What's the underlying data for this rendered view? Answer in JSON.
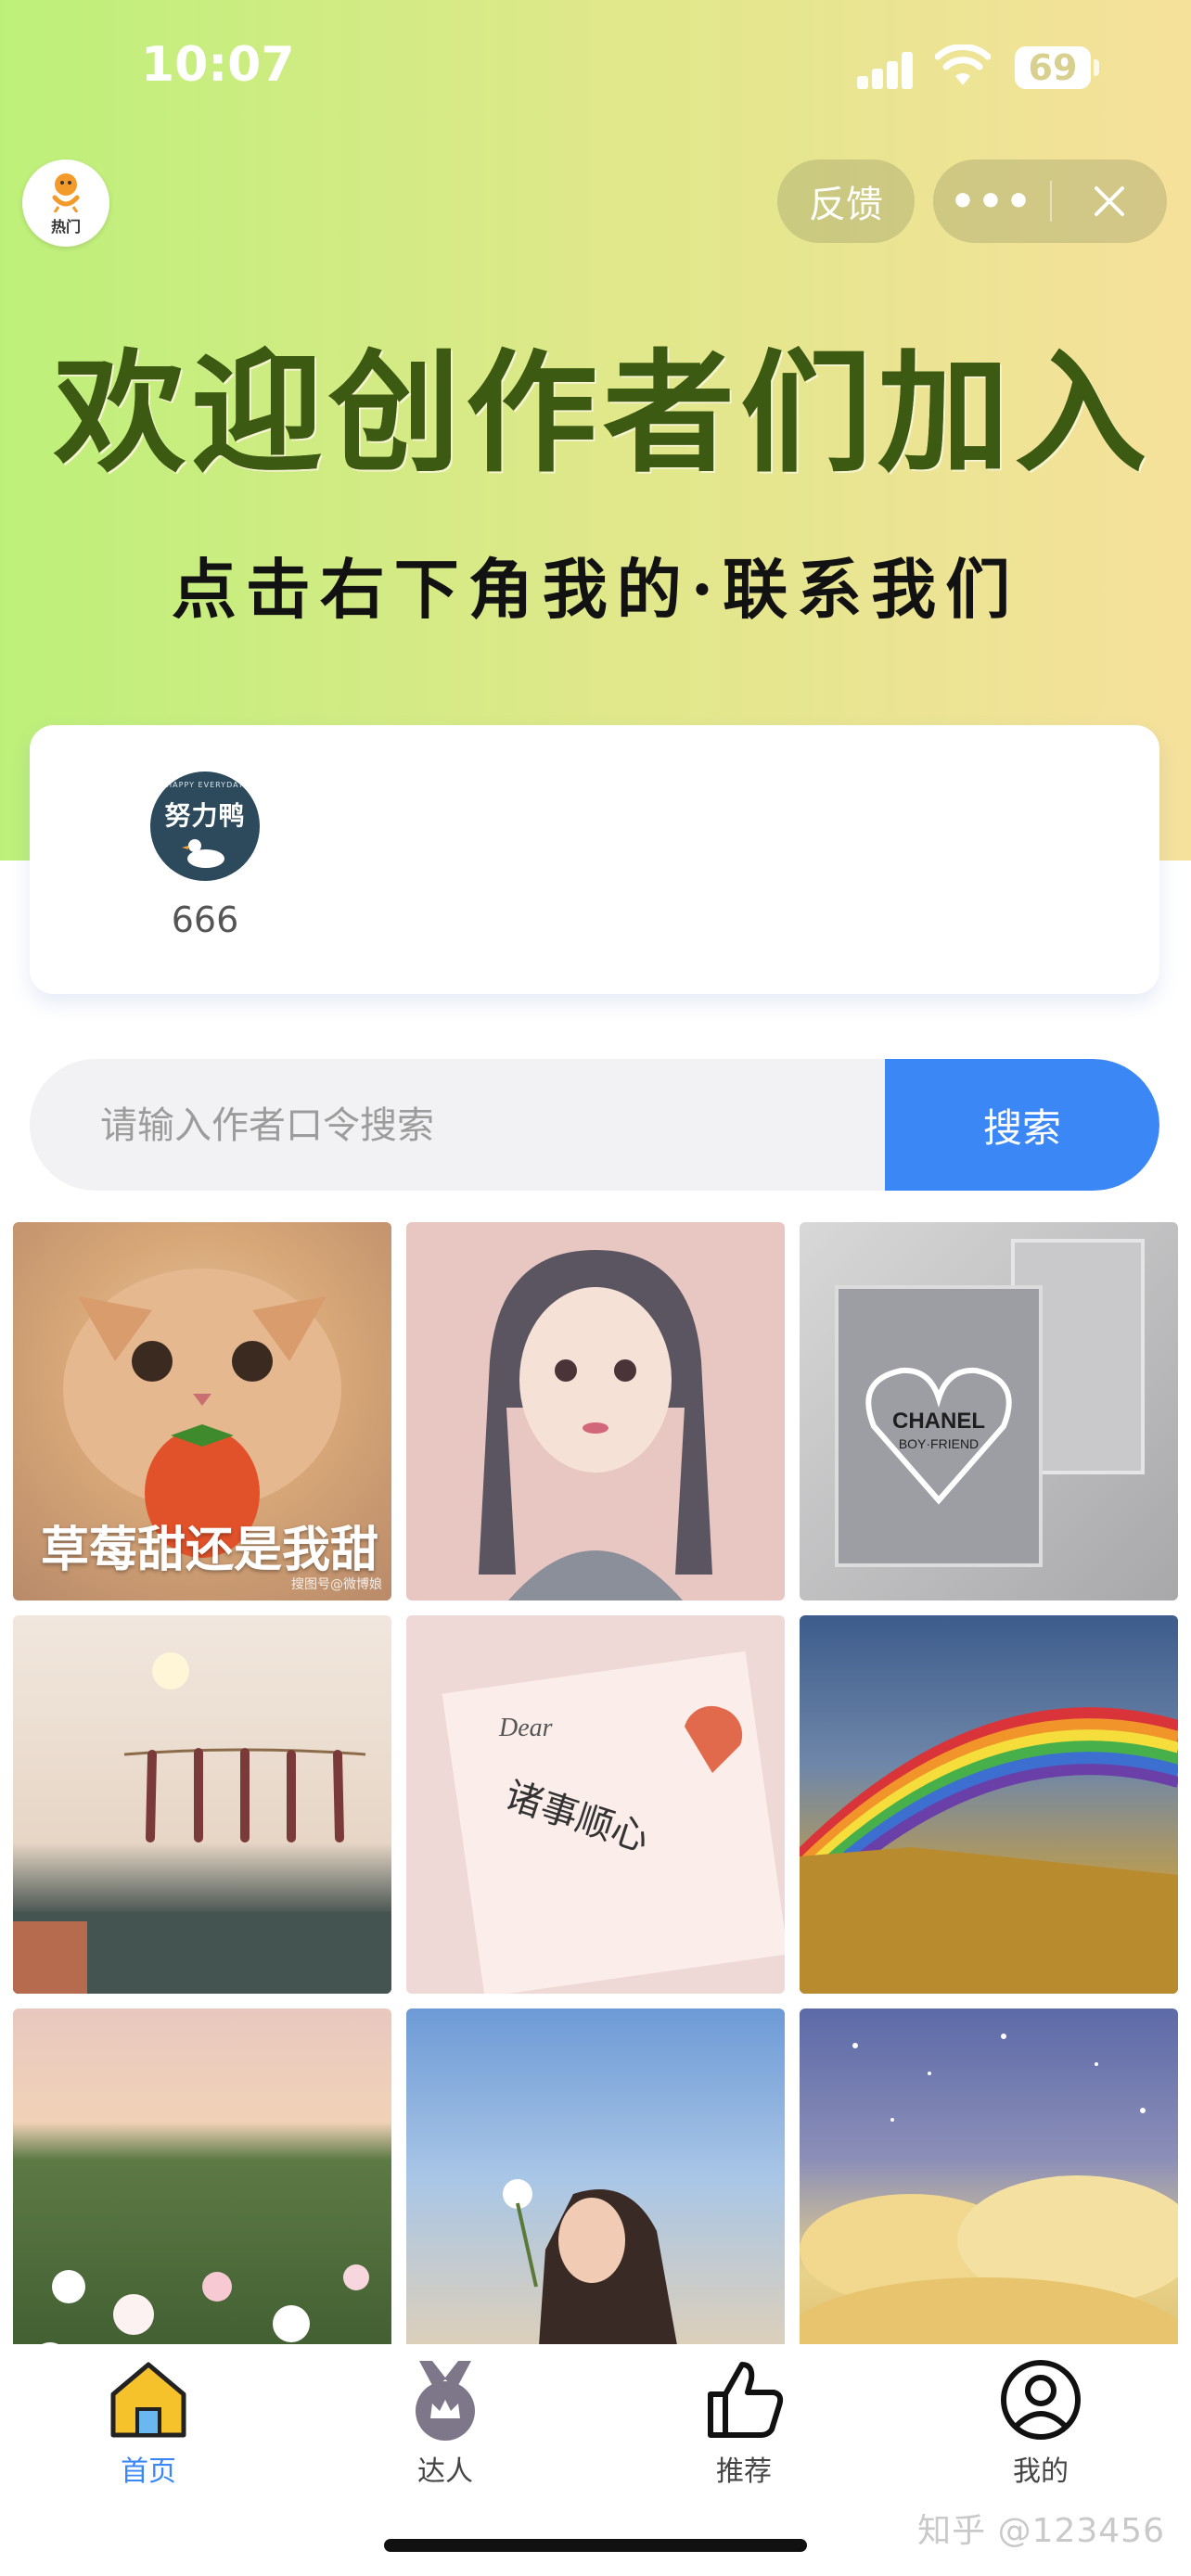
{
  "status_bar": {
    "time": "10:07",
    "battery": "69"
  },
  "header": {
    "avatar_label": "热门",
    "feedback_label": "反馈",
    "more_label": "•••"
  },
  "banner": {
    "headline": "欢迎创作者们加入",
    "subline": "点击右下角我的·联系我们"
  },
  "author_card": {
    "authors": [
      {
        "name": "666",
        "avatar_text": "努力鸭",
        "avatar_small": "HAPPY EVERYDAY"
      }
    ]
  },
  "search": {
    "placeholder": "请输入作者口令搜索",
    "button_label": "搜索"
  },
  "gallery": {
    "tiles": [
      {
        "caption": "草莓甜还是我甜",
        "sub": "搜图号@微博娘"
      },
      {
        "caption": ""
      },
      {
        "caption": ""
      },
      {
        "caption": ""
      },
      {
        "caption": ""
      },
      {
        "caption": ""
      },
      {
        "caption": ""
      },
      {
        "caption": ""
      },
      {
        "caption": ""
      }
    ],
    "chanel_text_1": "CHANEL",
    "chanel_text_2": "BOY·FRIEND",
    "card_text": "诸事顺心",
    "card_dear": "Dear"
  },
  "tabbar": {
    "tabs": [
      {
        "label": "首页",
        "icon": "home-icon",
        "active": true
      },
      {
        "label": "达人",
        "icon": "crown-medal-icon",
        "active": false
      },
      {
        "label": "推荐",
        "icon": "thumbs-up-icon",
        "active": false
      },
      {
        "label": "我的",
        "icon": "user-circle-icon",
        "active": false
      }
    ]
  },
  "watermark": "知乎 @123456",
  "colors": {
    "accent": "#3b87f5",
    "headline": "#3d5a12",
    "gradient_start": "#bdf07a",
    "gradient_end": "#f6e19b"
  }
}
